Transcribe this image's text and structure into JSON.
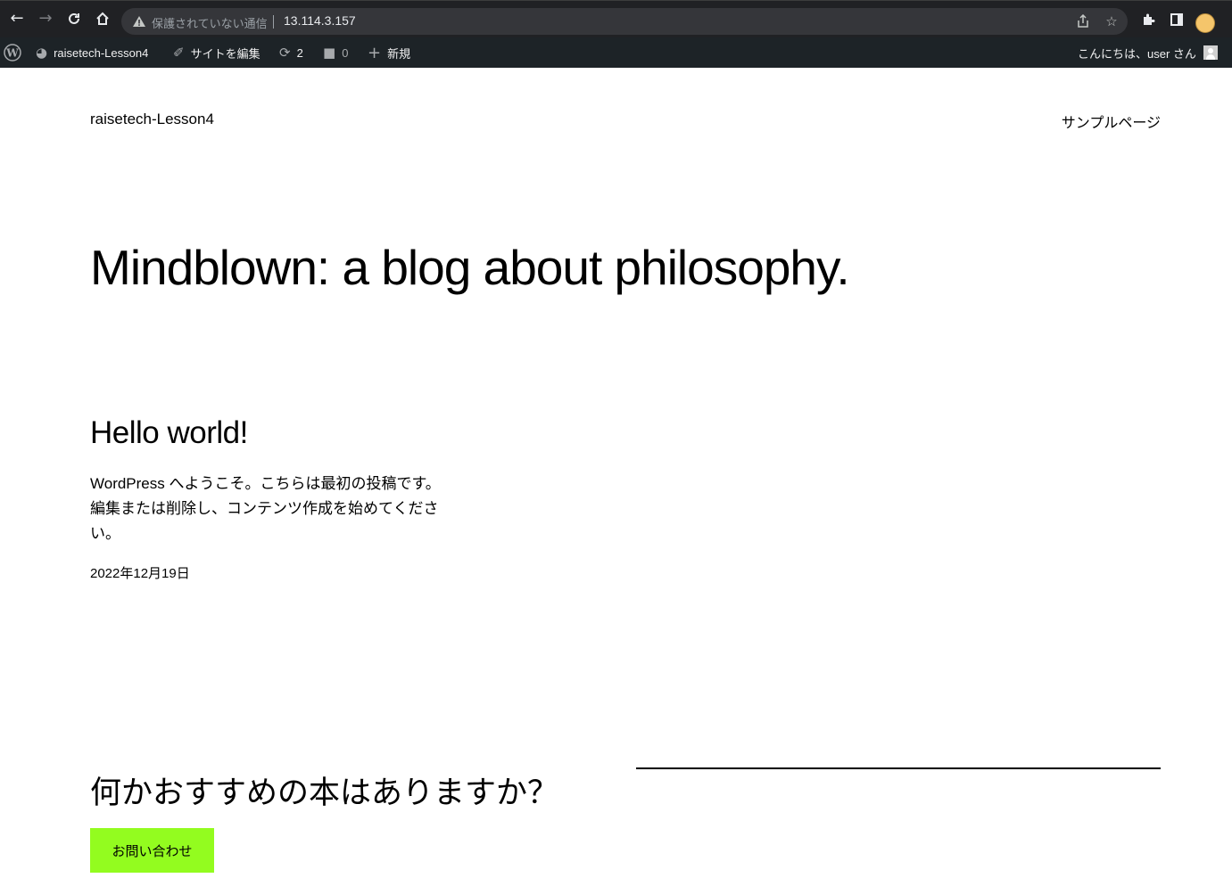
{
  "browser": {
    "security_label": "保護されていない通信",
    "url": "13.114.3.157",
    "nav_icons": [
      "back-arrow-icon",
      "forward-arrow-icon",
      "reload-icon",
      "home-icon"
    ],
    "omnibox_icons": [
      "warning-icon",
      "share-icon",
      "bookmark-star-icon"
    ],
    "toolbar_icons": [
      "extensions-icon",
      "side-panel-icon",
      "profile-avatar"
    ]
  },
  "admin_bar": {
    "site_name": "raisetech-Lesson4",
    "edit_site": "サイトを編集",
    "updates_count": "2",
    "comments_count": "0",
    "new_label": "新規",
    "greeting": "こんにちは、user さん"
  },
  "site": {
    "title": "raisetech-Lesson4",
    "nav": [
      "サンプルページ"
    ]
  },
  "hero": {
    "tagline": "Mindblown: a blog about philosophy."
  },
  "post": {
    "title": "Hello world!",
    "excerpt": "WordPress へようこそ。こちらは最初の投稿です。編集または削除し、コンテンツ作成を始めてください。",
    "date": "2022年12月19日"
  },
  "cta": {
    "heading": "何かおすすめの本はありますか？",
    "button_label": "お問い合わせ",
    "button_color": "#93fc1f"
  },
  "colors": {
    "chrome_bg": "#202124",
    "omnibox_bg": "#35363a",
    "admin_bar_bg": "#1d2327",
    "page_bg": "#ffffff"
  }
}
